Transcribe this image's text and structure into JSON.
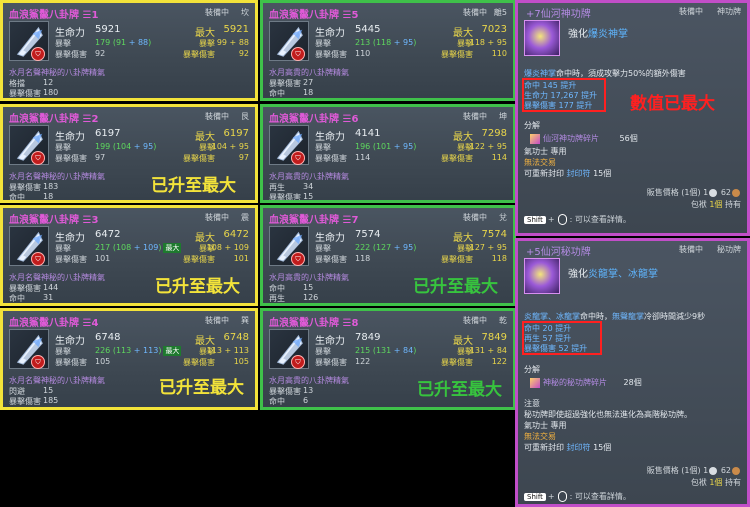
{
  "common": {
    "equipped": "裝備中",
    "stat_hp": "生命力",
    "stat_max": "最大",
    "crit_label": "暴擊",
    "crit_dmg_label": "暴擊傷害",
    "hit_label": "命中",
    "regen_label": "再生",
    "parry_label": "格擋",
    "dodge_label": "閃避",
    "desc": "水月名聲神秘的八卦牌精氣",
    "desc_alt": "水月高貴的八卦牌精氣",
    "max_chip": "最大",
    "overlay_max": "已升至最大"
  },
  "cards": [
    {
      "title": "血浪鯊鬣八卦牌",
      "slot": "1",
      "trigram": "坎",
      "hp": "5921",
      "hp_max": "5921",
      "crit_total": "179",
      "crit_base": "91",
      "crit_bonus": "88",
      "crit_max": "99",
      "crit_max_bonus": "88",
      "critdmg": "92",
      "critdmg_max": "92",
      "bottom": [
        [
          "格擋",
          "12"
        ],
        [
          "暴擊傷害",
          "180"
        ]
      ]
    },
    {
      "title": "血浪鯊鬣八卦牌",
      "slot": "2",
      "trigram": "艮",
      "hp": "6197",
      "hp_max": "6197",
      "crit_total": "199",
      "crit_base": "104",
      "crit_bonus": "95",
      "crit_max": "104",
      "crit_max_bonus": "95",
      "critdmg": "97",
      "critdmg_max": "97",
      "bottom": [
        [
          "暴擊傷害",
          "183"
        ],
        [
          "命中",
          "18"
        ]
      ]
    },
    {
      "title": "血浪鯊鬣八卦牌",
      "slot": "3",
      "trigram": "震",
      "hp": "6472",
      "hp_max": "6472",
      "crit_total": "217",
      "crit_base": "108",
      "crit_bonus": "109",
      "crit_max": "108",
      "crit_max_bonus": "109",
      "critdmg": "101",
      "critdmg_max": "101",
      "bottom": [
        [
          "暴擊傷害",
          "144"
        ],
        [
          "命中",
          "31"
        ]
      ]
    },
    {
      "title": "血浪鯊鬣八卦牌",
      "slot": "4",
      "trigram": "巽",
      "hp": "6748",
      "hp_max": "6748",
      "crit_total": "226",
      "crit_base": "113",
      "crit_bonus": "113",
      "crit_max": "113",
      "crit_max_bonus": "113",
      "critdmg": "105",
      "critdmg_max": "105",
      "bottom": [
        [
          "閃避",
          "15"
        ],
        [
          "暴擊傷害",
          "185"
        ]
      ]
    },
    {
      "title": "血浪鯊鬣八卦牌",
      "slot": "5",
      "trigram": "離5",
      "hp": "5445",
      "hp_max": "7023",
      "crit_total": "213",
      "crit_base": "118",
      "crit_bonus": "95",
      "crit_max": "118",
      "crit_max_bonus": "95",
      "critdmg": "110",
      "critdmg_max": "110",
      "bottom": [
        [
          "暴擊傷害",
          "27"
        ],
        [
          "命中",
          "18"
        ]
      ]
    },
    {
      "title": "血浪鯊鬣八卦牌",
      "slot": "6",
      "trigram": "坤",
      "hp": "4141",
      "hp_max": "7298",
      "crit_total": "196",
      "crit_base": "101",
      "crit_bonus": "95",
      "crit_max": "122",
      "crit_max_bonus": "95",
      "critdmg": "114",
      "critdmg_max": "114",
      "bottom": [
        [
          "再生",
          "34"
        ],
        [
          "暴擊傷害",
          "15"
        ]
      ]
    },
    {
      "title": "血浪鯊鬣八卦牌",
      "slot": "7",
      "trigram": "兌",
      "hp": "7574",
      "hp_max": "7574",
      "crit_total": "222",
      "crit_base": "127",
      "crit_bonus": "95",
      "crit_max": "127",
      "crit_max_bonus": "95",
      "critdmg": "118",
      "critdmg_max": "118",
      "bottom": [
        [
          "命中",
          "15"
        ],
        [
          "再生",
          "126"
        ]
      ]
    },
    {
      "title": "血浪鯊鬣八卦牌",
      "slot": "8",
      "trigram": "乾",
      "hp": "7849",
      "hp_max": "7849",
      "crit_total": "215",
      "crit_base": "131",
      "crit_bonus": "84",
      "crit_max": "131",
      "crit_max_bonus": "84",
      "critdmg": "122",
      "critdmg_max": "122",
      "bottom": [
        [
          "暴擊傷害",
          "13"
        ],
        [
          "命中",
          "6"
        ]
      ]
    }
  ],
  "tooltip_top": {
    "title": "+7仙河神功牌",
    "equipped": "裝備中",
    "category": "神功牌",
    "name_prefix": "強化",
    "name_highlight": "爆炎神掌",
    "effect_a": "爆炎神掌",
    "effect_b": "命中時，須成攻擊力50%的額外傷害",
    "stats": [
      [
        "命中",
        "145",
        "提升"
      ],
      [
        "生命力",
        "17,267",
        "提升"
      ],
      [
        "暴擊傷害",
        "177",
        "提升"
      ]
    ],
    "annotation": "數值已最大",
    "decompose_label": "分解",
    "material": "仙河神功牌碎片",
    "material_count": "56個",
    "sect": "氣功士 專用",
    "untradeable": "無法交易",
    "reseal": "可重新封印",
    "reseal_link": "封印符",
    "reseal_count": "15個",
    "price_label": "販售價格",
    "price_qty": "1個",
    "price_silver": "1",
    "price_copper": "62",
    "bag_label": "包袱",
    "bag_qty": "1個",
    "bag_suffix": "持有",
    "hint_key": "Shift",
    "hint_text": "可以查看詳情。"
  },
  "tooltip_bottom": {
    "title": "+5仙河秘功牌",
    "equipped": "裝備中",
    "category": "秘功牌",
    "name_prefix": "強化",
    "name_highlight": "炎龍掌、冰龍掌",
    "effect_a": "炎龍掌、冰龍掌",
    "effect_b": "命中時，",
    "effect_c": "無聲龍掌",
    "effect_d": "冷卻時間減少9秒",
    "stats": [
      [
        "命中",
        "20",
        "提升"
      ],
      [
        "再生",
        "57",
        "提升"
      ],
      [
        "暴擊傷害",
        "52",
        "提升"
      ]
    ],
    "decompose_label": "分解",
    "material": "神秘的秘功牌碎片",
    "material_count": "28個",
    "note_label": "注意",
    "note_text": "秘功牌即使超過強化也無法進化為高階秘功牌。",
    "sect": "氣功士 專用",
    "untradeable": "無法交易",
    "reseal": "可重新封印",
    "reseal_link": "封印符",
    "reseal_count": "15個",
    "price_label": "販售價格",
    "price_qty": "1個",
    "price_silver": "1",
    "price_copper": "62",
    "bag_label": "包袱",
    "bag_qty": "1個",
    "bag_suffix": "持有",
    "hint_key": "Shift",
    "hint_text": "可以查看詳情。"
  },
  "colors": {
    "yellow_frame": "#f3e33a",
    "green_frame": "#3fc14a",
    "purple_frame": "#c14ec8",
    "annotation_red": "#ff2020"
  }
}
